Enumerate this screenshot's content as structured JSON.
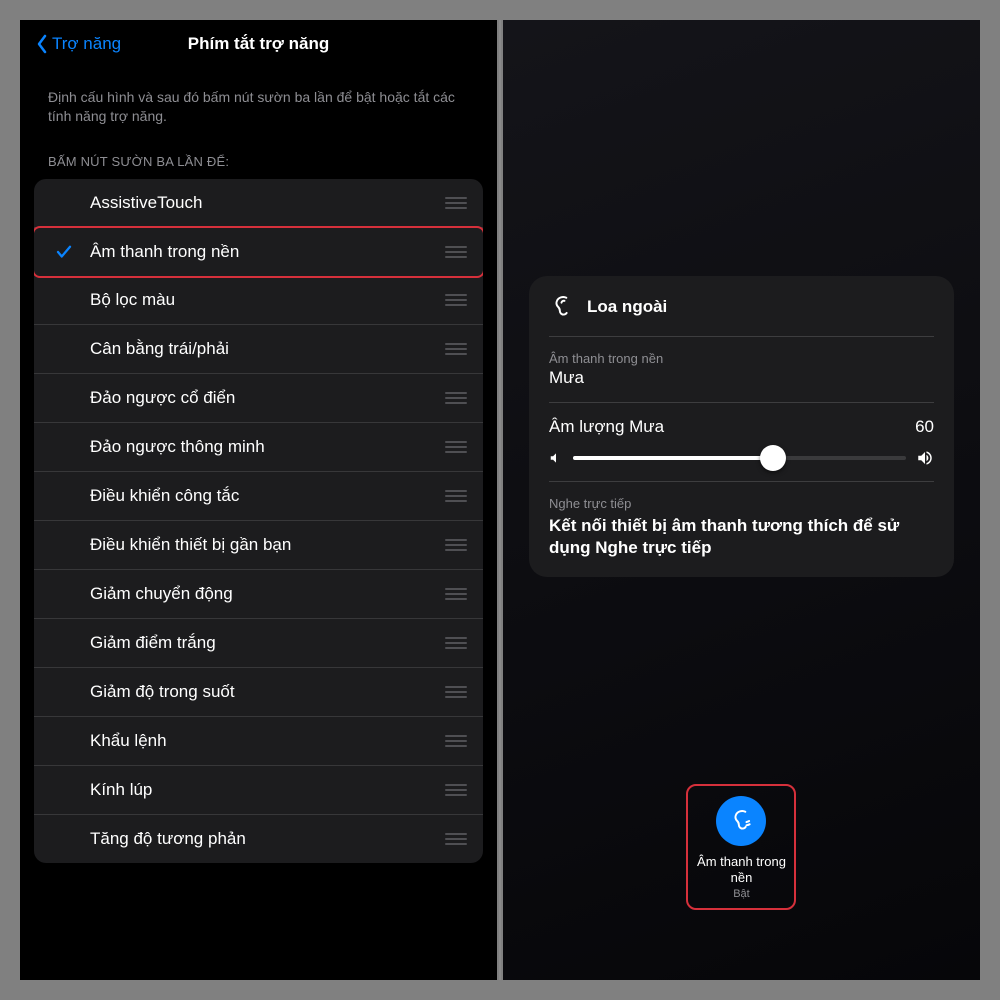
{
  "left": {
    "back_label": "Trợ năng",
    "title": "Phím tắt trợ năng",
    "intro": "Định cấu hình và sau đó bấm nút sườn ba lần để bật hoặc tắt các tính năng trợ năng.",
    "section_header": "BẤM NÚT SƯỜN BA LẦN ĐỂ:",
    "items": [
      {
        "label": "AssistiveTouch",
        "checked": false,
        "highlight": false
      },
      {
        "label": "Âm thanh trong nền",
        "checked": true,
        "highlight": true
      },
      {
        "label": "Bộ lọc màu",
        "checked": false,
        "highlight": false
      },
      {
        "label": "Cân bằng trái/phải",
        "checked": false,
        "highlight": false
      },
      {
        "label": "Đảo ngược cổ điển",
        "checked": false,
        "highlight": false
      },
      {
        "label": "Đảo ngược thông minh",
        "checked": false,
        "highlight": false
      },
      {
        "label": "Điều khiển công tắc",
        "checked": false,
        "highlight": false
      },
      {
        "label": "Điều khiển thiết bị gần bạn",
        "checked": false,
        "highlight": false
      },
      {
        "label": "Giảm chuyển động",
        "checked": false,
        "highlight": false
      },
      {
        "label": "Giảm điểm trắng",
        "checked": false,
        "highlight": false
      },
      {
        "label": "Giảm độ trong suốt",
        "checked": false,
        "highlight": false
      },
      {
        "label": "Khẩu lệnh",
        "checked": false,
        "highlight": false
      },
      {
        "label": "Kính lúp",
        "checked": false,
        "highlight": false
      },
      {
        "label": "Tăng độ tương phản",
        "checked": false,
        "highlight": false
      }
    ]
  },
  "right": {
    "card_title": "Loa ngoài",
    "bg_sound_label": "Âm thanh trong nền",
    "bg_sound_value": "Mưa",
    "volume_label": "Âm lượng Mưa",
    "volume_value": "60",
    "volume_percent": 60,
    "listen_header": "Nghe trực tiếp",
    "listen_body": "Kết nối thiết bị âm thanh tương thích để sử dụng Nghe trực tiếp",
    "tile_label": "Âm thanh trong nền",
    "tile_status": "Bật"
  }
}
